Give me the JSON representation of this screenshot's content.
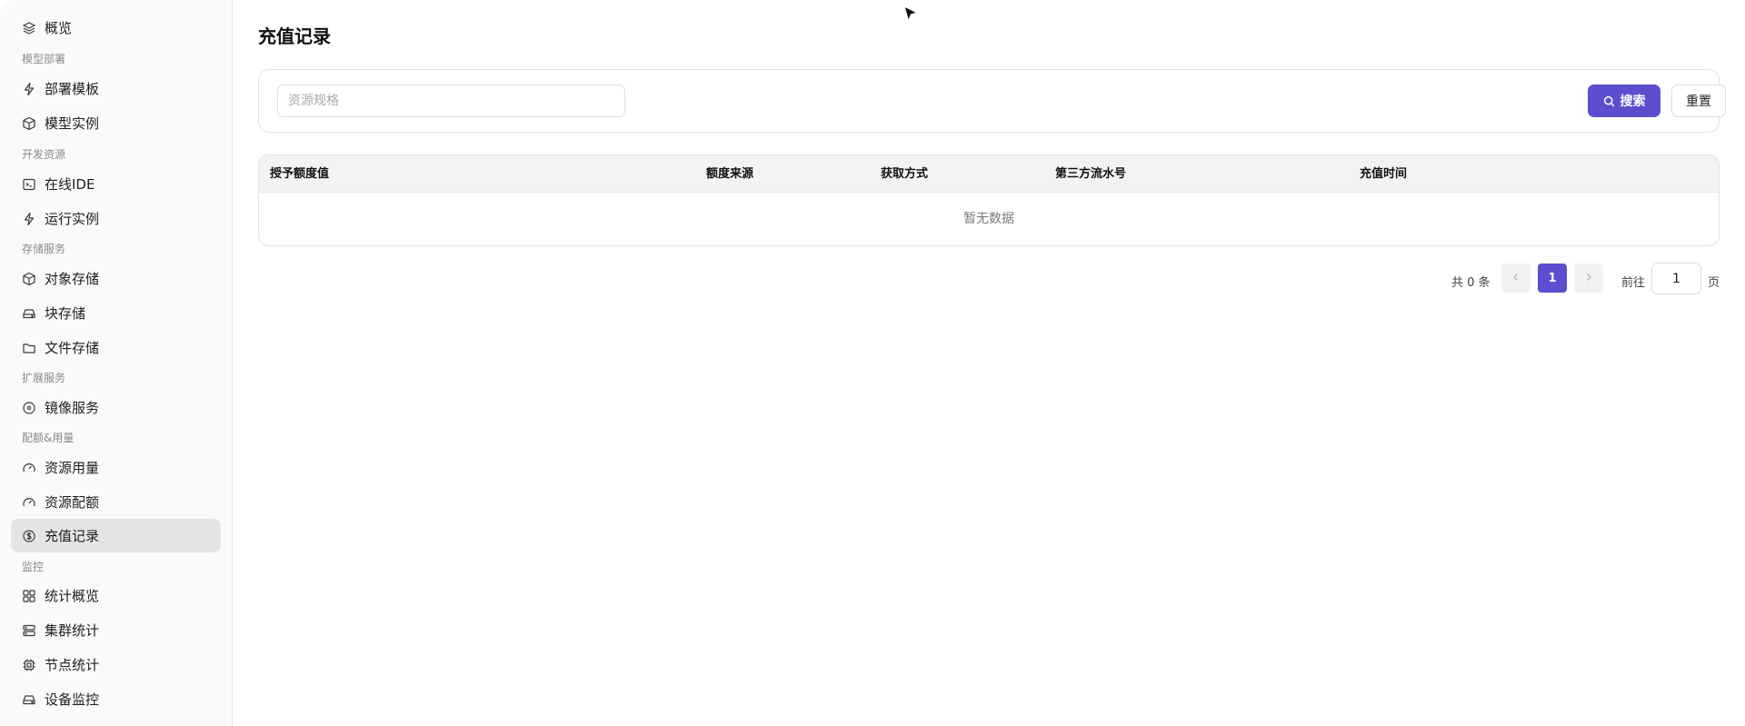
{
  "sidebar": {
    "items": [
      {
        "label": "概览",
        "icon": "layers-icon"
      },
      {
        "group": "模型部署"
      },
      {
        "label": "部署模板",
        "icon": "bolt-icon"
      },
      {
        "label": "模型实例",
        "icon": "cube-icon"
      },
      {
        "group": "开发资源"
      },
      {
        "label": "在线IDE",
        "icon": "terminal-icon"
      },
      {
        "label": "运行实例",
        "icon": "bolt-icon"
      },
      {
        "group": "存储服务"
      },
      {
        "label": "对象存储",
        "icon": "cube-icon"
      },
      {
        "label": "块存储",
        "icon": "hard-drive-icon"
      },
      {
        "label": "文件存储",
        "icon": "folder-icon"
      },
      {
        "group": "扩展服务"
      },
      {
        "label": "镜像服务",
        "icon": "disc-icon"
      },
      {
        "group": "配额&用量"
      },
      {
        "label": "资源用量",
        "icon": "gauge-icon"
      },
      {
        "label": "资源配额",
        "icon": "gauge-icon"
      },
      {
        "label": "充值记录",
        "icon": "dollar-circle-icon",
        "active": true
      },
      {
        "group": "监控"
      },
      {
        "label": "统计概览",
        "icon": "grid-icon"
      },
      {
        "label": "集群统计",
        "icon": "server-icon"
      },
      {
        "label": "节点统计",
        "icon": "cpu-icon"
      },
      {
        "label": "设备监控",
        "icon": "hard-drive-icon"
      }
    ]
  },
  "main": {
    "title": "充值记录",
    "filter": {
      "placeholder": "资源规格",
      "value": "",
      "search_label": "搜索",
      "reset_label": "重置"
    },
    "table": {
      "columns": [
        "授予额度值",
        "额度来源",
        "获取方式",
        "第三方流水号",
        "充值时间"
      ],
      "rows": [],
      "empty_text": "暂无数据"
    },
    "pagination": {
      "total_text": "共 0 条",
      "current_page": "1",
      "goto_label": "前往",
      "goto_value": "1",
      "page_suffix": "页"
    }
  },
  "colors": {
    "accent": "#5b4fcf",
    "sidebar_bg": "#fafafa",
    "active_item_bg": "#e4e4e6"
  }
}
